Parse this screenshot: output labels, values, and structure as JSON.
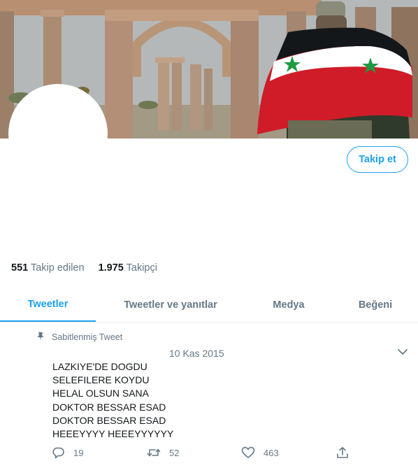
{
  "profile": {
    "follow_label": "Takip et",
    "following_count": "551",
    "following_label": "Takip edilen",
    "followers_count": "1.975",
    "followers_label": "Takipçi"
  },
  "tabs": [
    {
      "label": "Tweetler",
      "active": true
    },
    {
      "label": "Tweetler ve yanıtlar",
      "active": false
    },
    {
      "label": "Medya",
      "active": false
    },
    {
      "label": "Beğeni",
      "active": false
    }
  ],
  "tweet": {
    "pinned_label": "Sabitlenmiş Tweet",
    "date": "10 Kas 2015",
    "text": "LAZKIYE'DE DOGDU\nSELEFILERE KOYDU\nHELAL OLSUN SANA\nDOKTOR BESSAR ESAD\nDOKTOR BESSAR ESAD\nHEEEYYYY HEEEYYYYYY",
    "replies": "19",
    "retweets": "52",
    "likes": "463"
  },
  "colors": {
    "accent": "#1da1f2",
    "muted": "#657786",
    "flag_red": "#d01c28",
    "flag_green": "#1e9a43"
  },
  "icons": [
    "pin-icon",
    "chevron-down-icon",
    "reply-icon",
    "retweet-icon",
    "like-icon",
    "share-icon"
  ]
}
